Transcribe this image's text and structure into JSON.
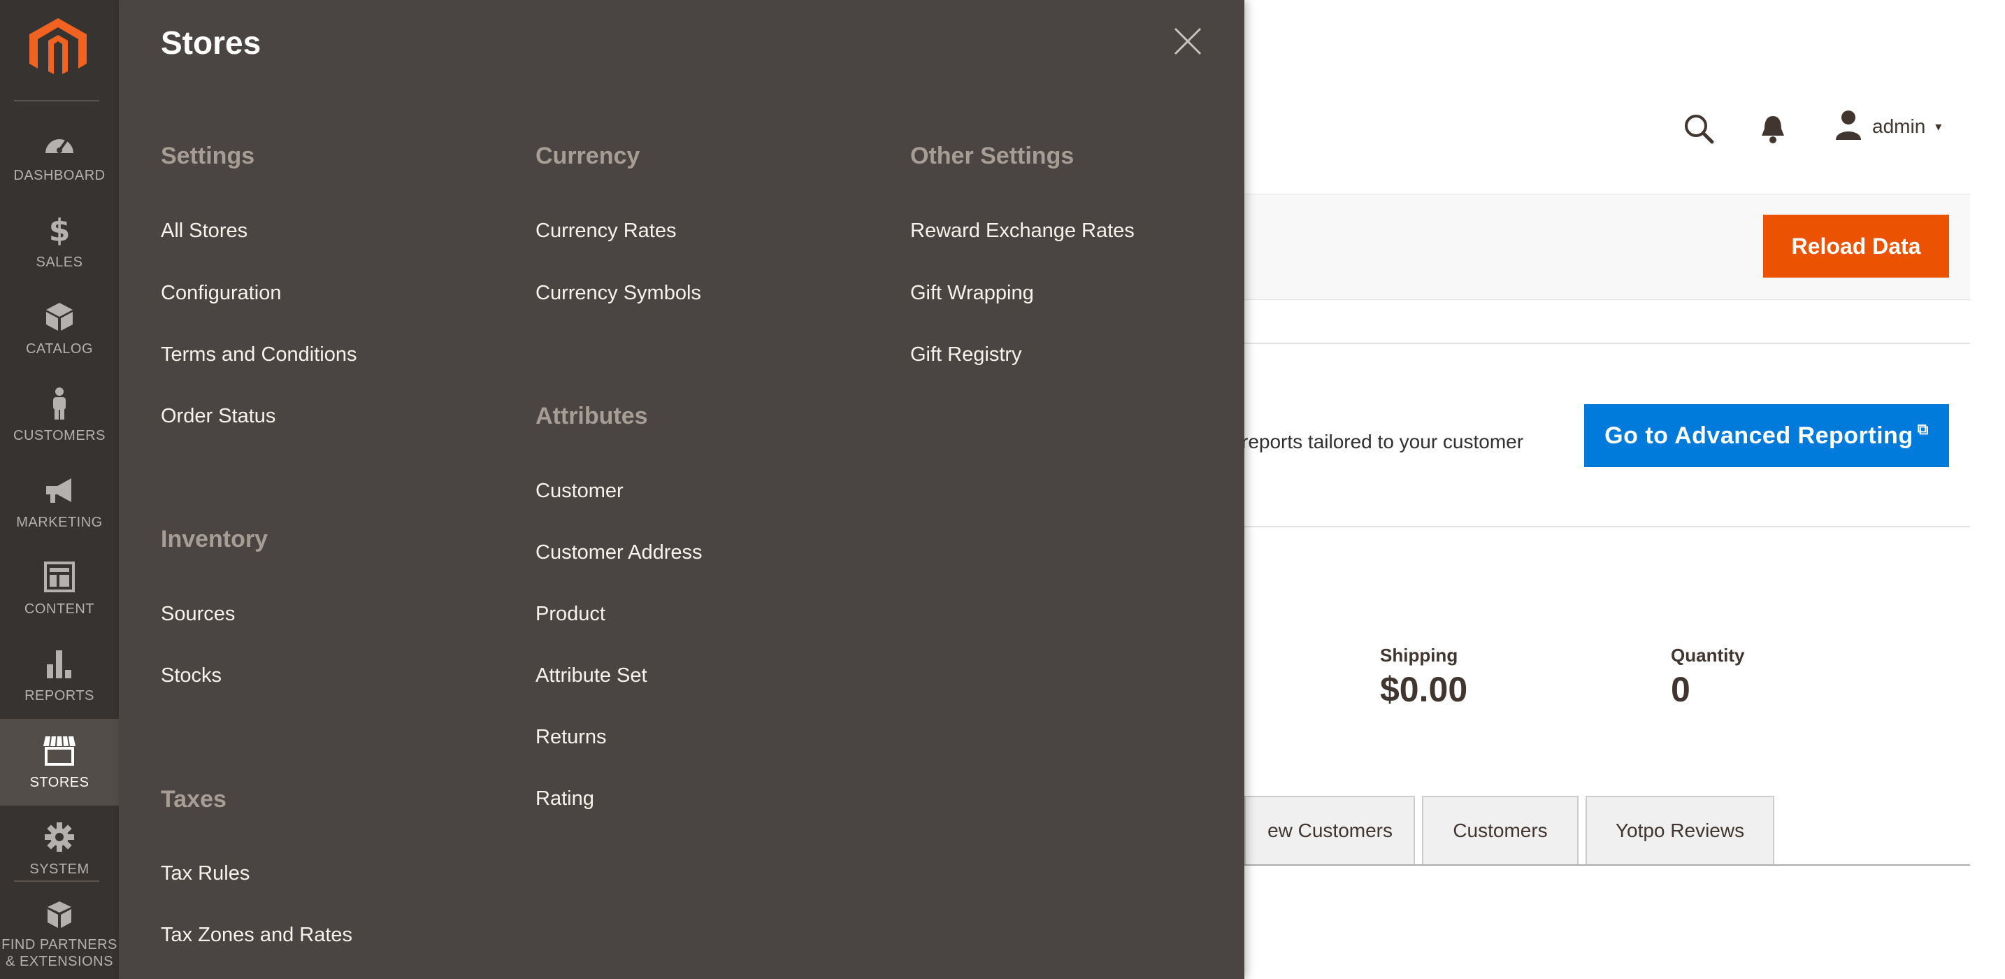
{
  "nav": {
    "items": [
      {
        "id": "dashboard",
        "label": "DASHBOARD"
      },
      {
        "id": "sales",
        "label": "SALES"
      },
      {
        "id": "catalog",
        "label": "CATALOG"
      },
      {
        "id": "customers",
        "label": "CUSTOMERS"
      },
      {
        "id": "marketing",
        "label": "MARKETING"
      },
      {
        "id": "content",
        "label": "CONTENT"
      },
      {
        "id": "reports",
        "label": "REPORTS"
      },
      {
        "id": "stores",
        "label": "STORES",
        "active": true
      },
      {
        "id": "system",
        "label": "SYSTEM"
      }
    ],
    "partners_line1": "FIND PARTNERS",
    "partners_line2": "& EXTENSIONS",
    "logo_color": "#f26322"
  },
  "header": {
    "user_name": "admin",
    "caret": "▾"
  },
  "actions": {
    "reload_label": "Reload Data"
  },
  "advanced_reporting": {
    "text_fragment": "reports tailored to your customer",
    "button_label": "Go to Advanced Reporting",
    "external_glyph": "⧉"
  },
  "stats": [
    {
      "label": "Shipping",
      "value": "$0.00"
    },
    {
      "label": "Quantity",
      "value": "0"
    }
  ],
  "tabs": [
    {
      "label": "ew Customers"
    },
    {
      "label": "Customers"
    },
    {
      "label": "Yotpo Reviews"
    }
  ],
  "stores_panel": {
    "title": "Stores",
    "settings": {
      "heading": "Settings",
      "links": [
        "All Stores",
        "Configuration",
        "Terms and Conditions",
        "Order Status"
      ]
    },
    "inventory": {
      "heading": "Inventory",
      "links": [
        "Sources",
        "Stocks"
      ]
    },
    "taxes": {
      "heading": "Taxes",
      "links": [
        "Tax Rules",
        "Tax Zones and Rates"
      ]
    },
    "currency": {
      "heading": "Currency",
      "links": [
        "Currency Rates",
        "Currency Symbols"
      ]
    },
    "attributes": {
      "heading": "Attributes",
      "links": [
        "Customer",
        "Customer Address",
        "Product",
        "Attribute Set",
        "Returns",
        "Rating"
      ]
    },
    "other": {
      "heading": "Other Settings",
      "links": [
        "Reward Exchange Rates",
        "Gift Wrapping",
        "Gift Registry"
      ]
    }
  },
  "colors": {
    "nav_bg": "#373330",
    "panel_bg": "#4a4542",
    "accent_orange": "#eb5202",
    "accent_blue": "#007bdb"
  }
}
